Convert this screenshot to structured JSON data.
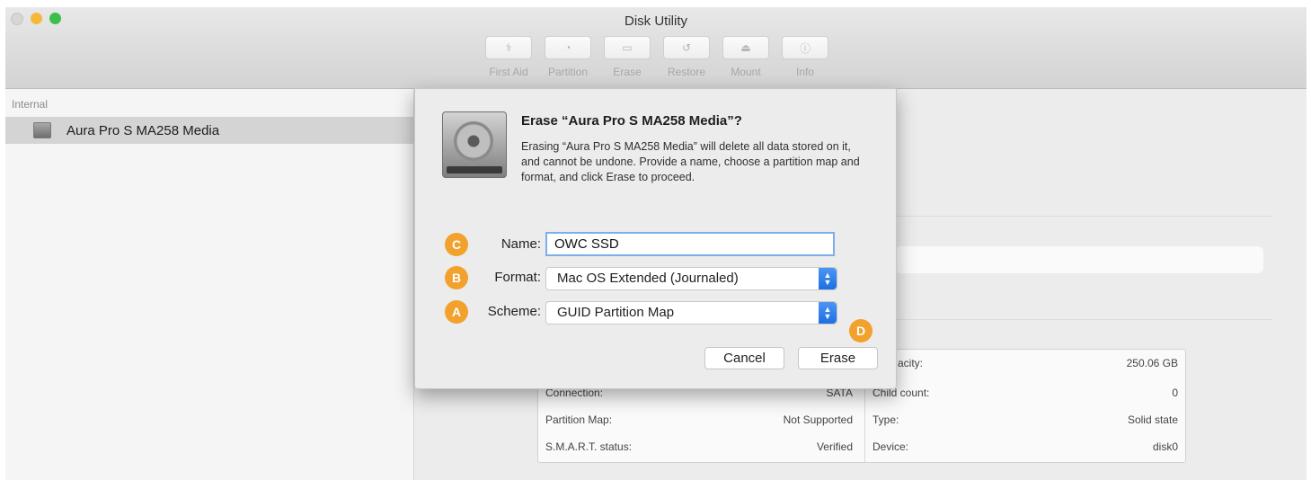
{
  "window": {
    "title": "Disk Utility"
  },
  "toolbar": {
    "items": [
      {
        "label": "First Aid",
        "icon": "first-aid-icon",
        "glyph": "⚕"
      },
      {
        "label": "Partition",
        "icon": "partition-icon",
        "glyph": "◔"
      },
      {
        "label": "Erase",
        "icon": "erase-icon",
        "glyph": "▭"
      },
      {
        "label": "Restore",
        "icon": "restore-icon",
        "glyph": "↺"
      },
      {
        "label": "Mount",
        "icon": "mount-icon",
        "glyph": "⏏"
      },
      {
        "label": "Info",
        "icon": "info-icon",
        "glyph": "ⓘ"
      }
    ]
  },
  "sidebar": {
    "section": "Internal",
    "items": [
      {
        "label": "Aura Pro S MA258 Media",
        "icon": "disk-icon"
      }
    ]
  },
  "dialog": {
    "title": "Erase “Aura Pro S MA258 Media”?",
    "message": "Erasing “Aura Pro S MA258 Media” will delete all data stored on it, and cannot be undone. Provide a name, choose a partition map and format, and click Erase to proceed.",
    "name_label": "Name:",
    "name_value": "OWC SSD",
    "format_label": "Format:",
    "format_value": "Mac OS Extended (Journaled)",
    "scheme_label": "Scheme:",
    "scheme_value": "GUID Partition Map",
    "cancel_label": "Cancel",
    "erase_label": "Erase",
    "badges": {
      "name": "C",
      "format": "B",
      "scheme": "A",
      "erase": "D"
    }
  },
  "info": {
    "rows": [
      {
        "left_label": "",
        "left_value": "",
        "right_label": "acity:",
        "right_value": "250.06 GB"
      },
      {
        "left_label": "Connection:",
        "left_value": "SATA",
        "right_label": "Child count:",
        "right_value": "0"
      },
      {
        "left_label": "Partition Map:",
        "left_value": "Not Supported",
        "right_label": "Type:",
        "right_value": "Solid state"
      },
      {
        "left_label": "S.M.A.R.T. status:",
        "left_value": "Verified",
        "right_label": "Device:",
        "right_value": "disk0"
      }
    ]
  },
  "colors": {
    "badge": "#f1a12c",
    "selection_arrow": "#1d6fe3",
    "focus_ring": "#7eaee9"
  }
}
